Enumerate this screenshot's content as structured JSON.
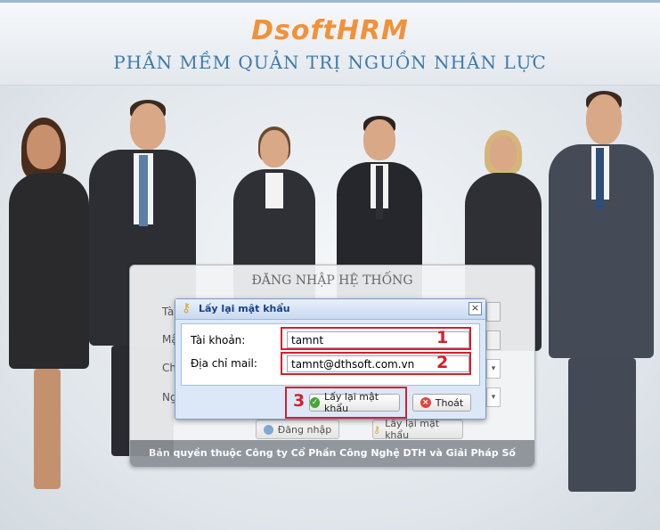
{
  "header": {
    "logo": "DsoftHRM",
    "subtitle": "PHẦN MỀM QUẢN TRỊ NGUỒN NHÂN LỰC"
  },
  "login": {
    "title": "ĐĂNG NHẬP HỆ THỐNG",
    "labels": [
      "Tà",
      "Mậ",
      "Ch",
      "Ng"
    ],
    "login_button": "Đăng nhập",
    "recover_button": "Lấy lại mật khẩu",
    "footer": "Bản quyền thuộc Công ty Cổ Phần Công Nghệ DTH và Giải Pháp Số"
  },
  "dialog": {
    "title": "Lấy lại mật khẩu",
    "close": "×",
    "account_label": "Tài khoản:",
    "account_value": "tamnt",
    "email_label": "Địa chỉ mail:",
    "email_value": "tamnt@dthsoft.com.vn",
    "recover_button": "Lấy lại mật khẩu",
    "exit_button": "Thoát"
  },
  "annotations": {
    "one": "1",
    "two": "2",
    "three": "3"
  },
  "colors": {
    "logo": "#f0923a",
    "subtitle": "#3d7aa9",
    "highlight": "#d3212c",
    "dialog_title": "#15428b"
  },
  "icons": [
    "key-icon",
    "close-icon",
    "check-icon",
    "cancel-icon",
    "user-icon",
    "key-icon"
  ]
}
